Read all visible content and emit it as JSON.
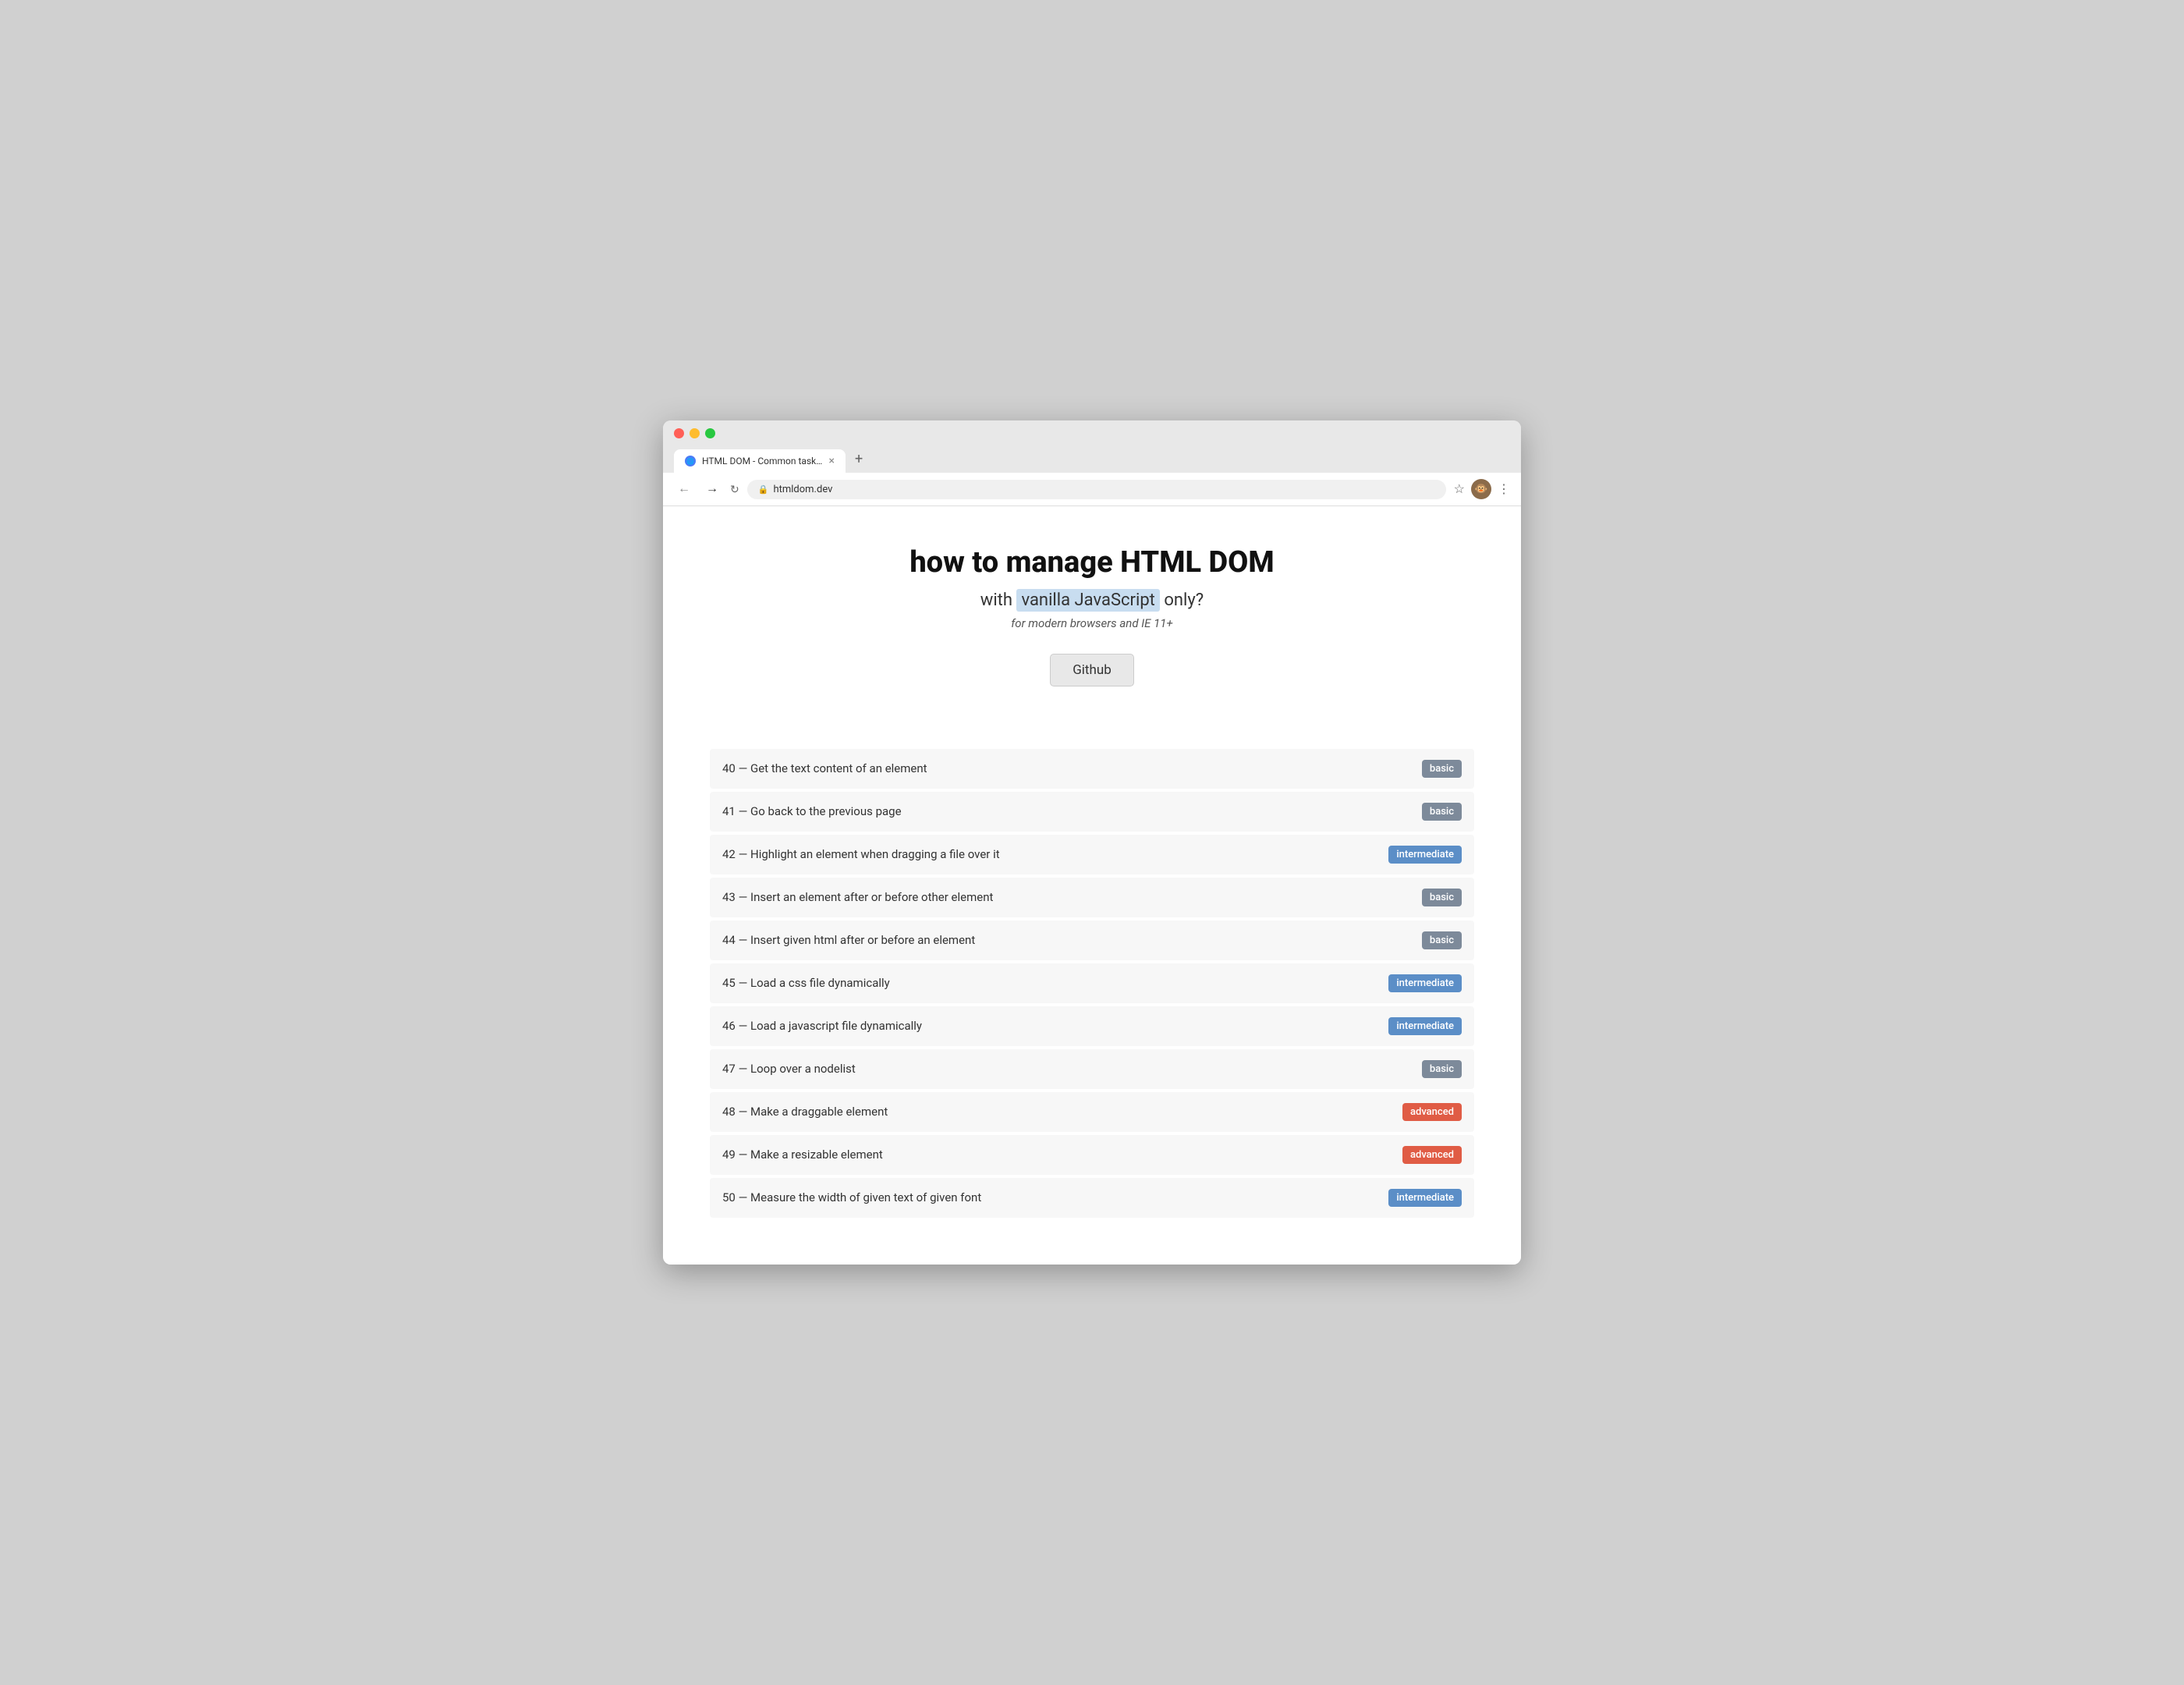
{
  "browser": {
    "url": "htmldom.dev",
    "tab_title": "HTML DOM - Common tasks of",
    "tab_icon": "🌐"
  },
  "header": {
    "title": "how to manage HTML DOM",
    "subtitle_prefix": "with ",
    "subtitle_highlight": "vanilla JavaScript",
    "subtitle_suffix": " only?",
    "description": "for modern browsers and IE 11+",
    "github_label": "Github"
  },
  "tasks": [
    {
      "id": 40,
      "label": "40 — Get the text content of an element",
      "difficulty": "basic",
      "badge_class": "badge-basic"
    },
    {
      "id": 41,
      "label": "41 — Go back to the previous page",
      "difficulty": "basic",
      "badge_class": "badge-basic"
    },
    {
      "id": 42,
      "label": "42 — Highlight an element when dragging a file over it",
      "difficulty": "intermediate",
      "badge_class": "badge-intermediate"
    },
    {
      "id": 43,
      "label": "43 — Insert an element after or before other element",
      "difficulty": "basic",
      "badge_class": "badge-basic"
    },
    {
      "id": 44,
      "label": "44 — Insert given html after or before an element",
      "difficulty": "basic",
      "badge_class": "badge-basic"
    },
    {
      "id": 45,
      "label": "45 — Load a css file dynamically",
      "difficulty": "intermediate",
      "badge_class": "badge-intermediate"
    },
    {
      "id": 46,
      "label": "46 — Load a javascript file dynamically",
      "difficulty": "intermediate",
      "badge_class": "badge-intermediate"
    },
    {
      "id": 47,
      "label": "47 — Loop over a nodelist",
      "difficulty": "basic",
      "badge_class": "badge-basic"
    },
    {
      "id": 48,
      "label": "48 — Make a draggable element",
      "difficulty": "advanced",
      "badge_class": "badge-advanced"
    },
    {
      "id": 49,
      "label": "49 — Make a resizable element",
      "difficulty": "advanced",
      "badge_class": "badge-advanced"
    },
    {
      "id": 50,
      "label": "50 — Measure the width of given text of given font",
      "difficulty": "intermediate",
      "badge_class": "badge-intermediate"
    }
  ]
}
